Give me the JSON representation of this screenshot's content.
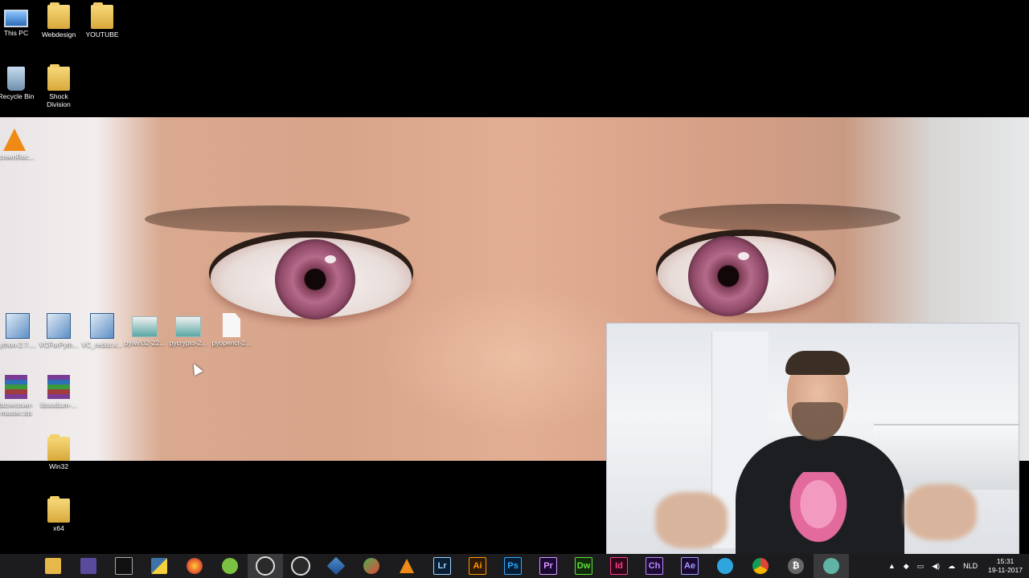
{
  "desktop_icons": [
    {
      "label": "This PC",
      "icon": "pc-icon"
    },
    {
      "label": "Webdesign",
      "icon": "folder-icon"
    },
    {
      "label": "YOUTUBE",
      "icon": "folder-icon"
    },
    {
      "label": "Recycle Bin",
      "icon": "recycle-bin-icon"
    },
    {
      "label": "Shock Division",
      "icon": "folder-icon"
    },
    {
      "label": "ScreenRec...",
      "icon": "vlc-icon"
    },
    {
      "label": "ython-2.7....",
      "icon": "setup-icon"
    },
    {
      "label": "VCForPyth...",
      "icon": "setup-icon"
    },
    {
      "label": "VC_redist.x...",
      "icon": "setup-icon"
    },
    {
      "label": "pywin32-22...",
      "icon": "package-icon"
    },
    {
      "label": "pycrypto-2...",
      "icon": "package-icon"
    },
    {
      "label": "pyopencl-2...",
      "icon": "file-icon"
    },
    {
      "label": "btcrecover-master.zip",
      "icon": "archive-icon"
    },
    {
      "label": "libsodium-...",
      "icon": "archive-icon"
    },
    {
      "label": "Win32",
      "icon": "folder-icon"
    },
    {
      "label": "x64",
      "icon": "folder-icon"
    }
  ],
  "taskbar": {
    "apps": [
      {
        "name": "start",
        "label": ""
      },
      {
        "name": "file-explorer",
        "label": ""
      },
      {
        "name": "visual-studio",
        "label": ""
      },
      {
        "name": "command-prompt",
        "label": ""
      },
      {
        "name": "python",
        "label": ""
      },
      {
        "name": "firefox",
        "label": ""
      },
      {
        "name": "android-studio",
        "label": ""
      },
      {
        "name": "obs",
        "label": ""
      },
      {
        "name": "obs-2",
        "label": ""
      },
      {
        "name": "virtualbox",
        "label": ""
      },
      {
        "name": "vpn",
        "label": ""
      },
      {
        "name": "vlc",
        "label": ""
      },
      {
        "name": "lightroom",
        "label": "Lr"
      },
      {
        "name": "illustrator",
        "label": "Ai"
      },
      {
        "name": "photoshop",
        "label": "Ps"
      },
      {
        "name": "premiere",
        "label": "Pr"
      },
      {
        "name": "dreamweaver",
        "label": "Dw"
      },
      {
        "name": "indesign",
        "label": "Id"
      },
      {
        "name": "character-animator",
        "label": "Ch"
      },
      {
        "name": "after-effects",
        "label": "Ae"
      },
      {
        "name": "telegram",
        "label": ""
      },
      {
        "name": "chrome",
        "label": ""
      },
      {
        "name": "bitcoin",
        "label": ""
      },
      {
        "name": "atom",
        "label": ""
      }
    ],
    "tray": {
      "language": "NLD",
      "time": "15:31",
      "date": "19-11-2017"
    }
  }
}
